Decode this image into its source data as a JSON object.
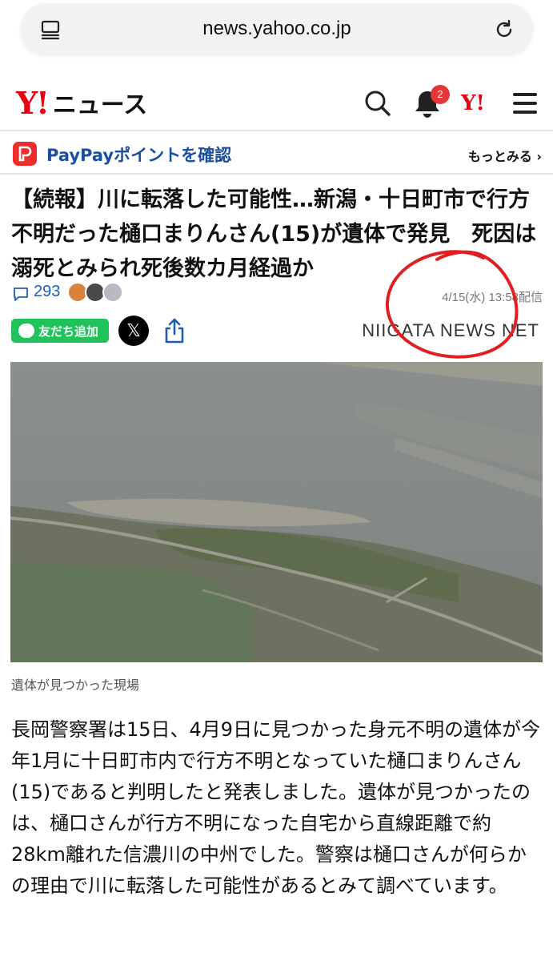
{
  "browser": {
    "url": "news.yahoo.co.jp",
    "tabs_icon": "tabs-icon",
    "reload_icon": "reload-icon"
  },
  "header": {
    "logo_y": "Y!",
    "logo_news": "ニュース",
    "notification_count": "2",
    "yahoo_mini_logo": "Y!"
  },
  "paypay": {
    "label": "PayPayポイントを確認",
    "more": "もっとみる",
    "chevron": "›"
  },
  "article": {
    "headline": "【続報】川に転落した可能性…新潟・十日町市で行方不明だった樋口まりんさん(15)が遺体で発見　死因は溺死とみられ死後数カ月経過か",
    "comment_count": "293",
    "date": "4/15(水) 13:58配信",
    "line_button": "友だち追加",
    "x_button": "𝕏",
    "source_logo": "NIIGATA NEWS NET",
    "photo_caption": "遺体が見つかった現場",
    "body": "長岡警察署は15日、4月9日に見つかった身元不明の遺体が今年1月に十日町市内で行方不明となっていた樋口まりんさん(15)であると判明したと発表しました。遺体が見つかったのは、樋口さんが行方不明になった自宅から直線距離で約28km離れた信濃川の中州でした。警察は樋口さんが何らかの理由で川に転落した可能性があるとみて調べています。"
  },
  "colors": {
    "brand_red": "#e60012",
    "link_blue": "#1a5fb4",
    "line_green": "#20c35a",
    "annotation_red": "#e02020"
  }
}
